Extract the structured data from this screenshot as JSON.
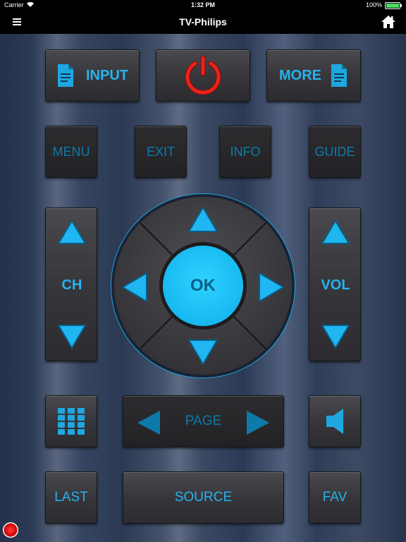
{
  "status_bar": {
    "carrier": "Carrier",
    "time": "1:32 PM",
    "battery": "100%"
  },
  "nav": {
    "title": "TV-Philips",
    "menu_icon": "hamburger-menu-icon",
    "home_icon": "home-icon"
  },
  "buttons": {
    "input": "INPUT",
    "power_icon": "power-icon",
    "more": "MORE",
    "menu": "MENU",
    "exit": "EXIT",
    "info": "INFO",
    "guide": "GUIDE",
    "ch": "CH",
    "vol": "VOL",
    "ok": "OK",
    "page": "PAGE",
    "last": "LAST",
    "source": "SOURCE",
    "fav": "FAV"
  },
  "colors": {
    "accent": "#1fa7e0",
    "ok_fill": "#17b8f0",
    "power": "#e8241c",
    "record": "#e00000"
  }
}
